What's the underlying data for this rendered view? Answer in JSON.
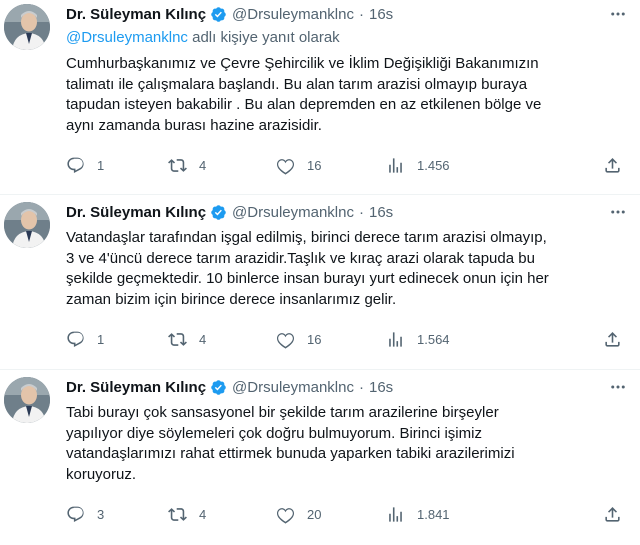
{
  "tweets": [
    {
      "author_name": "Dr. Süleyman Kılınç",
      "handle": "@Drsuleymanklnc",
      "separator": "·",
      "time": "16s",
      "reply_to_handle": "@Drsuleymanklnc",
      "reply_to_suffix": " adlı kişiye yanıt olarak",
      "lines": [
        "Cumhurbaşkanımız ve Çevre  Şehircilik ve İklim Değişikliği Bakanımızın",
        "talimatı ile çalışmalara başlandı. Bu alan tarım arazisi olmayıp buraya",
        "tapudan isteyen bakabilir . Bu alan depremden en az etkilenen bölge ve",
        "aynı zamanda burası hazine arazisidir."
      ],
      "replies": "1",
      "retweets": "4",
      "likes": "16",
      "views": "1.456"
    },
    {
      "author_name": "Dr. Süleyman Kılınç",
      "handle": "@Drsuleymanklnc",
      "separator": "·",
      "time": "16s",
      "lines": [
        "Vatandaşlar tarafından işgal edilmiş, birinci derece tarım arazisi olmayıp,",
        "3 ve 4'üncü  derece tarım arazidir.Taşlık ve kıraç arazi olarak tapuda bu",
        "şekilde geçmektedir. 10 binlerce insan burayı yurt edinecek onun için her",
        "zaman  bizim için birince derece insanlarımız gelir."
      ],
      "replies": "1",
      "retweets": "4",
      "likes": "16",
      "views": "1.564"
    },
    {
      "author_name": "Dr. Süleyman Kılınç",
      "handle": "@Drsuleymanklnc",
      "separator": "·",
      "time": "16s",
      "lines": [
        "Tabi burayı çok sansasyonel  bir şekilde tarım arazilerine birşeyler",
        "yapılıyor diye söylemeleri çok doğru  bulmuyorum. Birinci işimiz",
        "vatandaşlarımızı rahat ettirmek bunuda yaparken tabiki arazilerimizi",
        "koruyoruz."
      ],
      "replies": "3",
      "retweets": "4",
      "likes": "20",
      "views": "1.841"
    }
  ],
  "colors": {
    "text": "#0f1419",
    "secondary": "#536471",
    "accent": "#1d9bf0",
    "divider": "#eff3f4"
  },
  "icons": {
    "verified": "verified-badge-icon",
    "more": "more-dots-icon",
    "reply": "reply-icon",
    "retweet": "retweet-icon",
    "like": "heart-icon",
    "views": "analytics-icon",
    "share": "share-icon"
  }
}
